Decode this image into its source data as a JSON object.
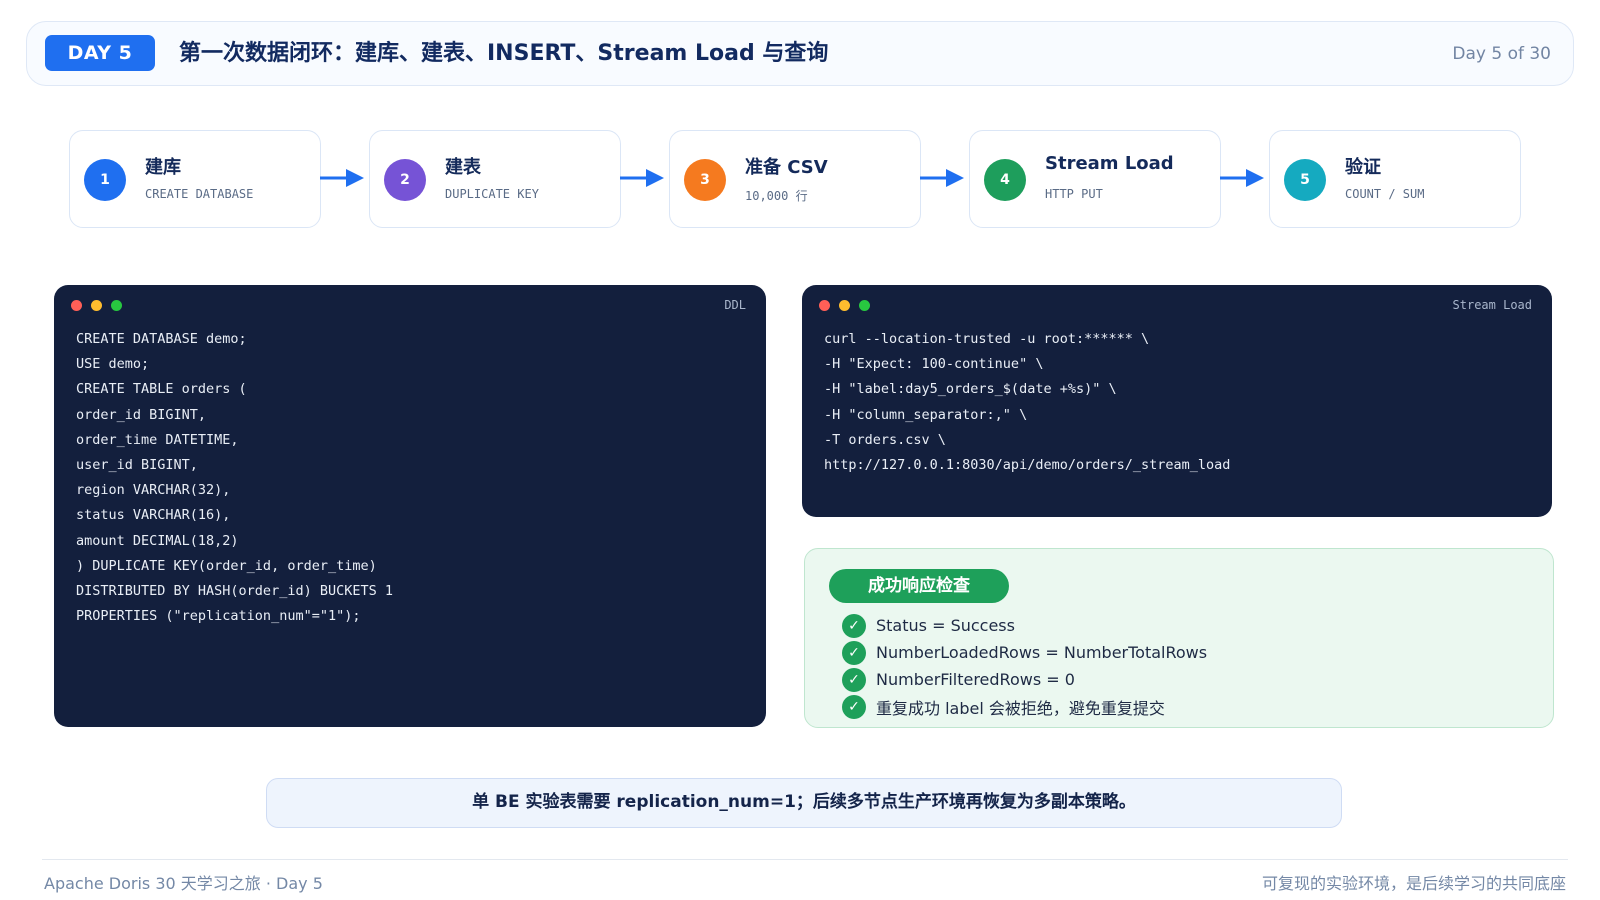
{
  "header": {
    "badge": "DAY 5",
    "title": "第一次数据闭环：建库、建表、INSERT、Stream Load 与查询",
    "progress": "Day 5 of 30"
  },
  "steps": [
    {
      "number": "1",
      "title": "建库",
      "subtitle": "CREATE DATABASE",
      "color": "#1f6ff0"
    },
    {
      "number": "2",
      "title": "建表",
      "subtitle": "DUPLICATE KEY",
      "color": "#7653d6"
    },
    {
      "number": "3",
      "title": "准备 CSV",
      "subtitle": "10,000 行",
      "color": "#f57a1f"
    },
    {
      "number": "4",
      "title": "Stream Load",
      "subtitle": "HTTP PUT",
      "color": "#1e9e5c"
    },
    {
      "number": "5",
      "title": "验证",
      "subtitle": "COUNT / SUM",
      "color": "#15aac0"
    }
  ],
  "ddl_panel": {
    "label": "DDL",
    "lines": [
      "CREATE DATABASE demo;",
      "USE demo;",
      "CREATE TABLE orders (",
      "order_id BIGINT,",
      "order_time DATETIME,",
      "user_id BIGINT,",
      "region VARCHAR(32),",
      "status VARCHAR(16),",
      "amount DECIMAL(18,2)",
      ") DUPLICATE KEY(order_id, order_time)",
      "DISTRIBUTED BY HASH(order_id) BUCKETS 1",
      "PROPERTIES (\"replication_num\"=\"1\");"
    ]
  },
  "stream_panel": {
    "label": "Stream Load",
    "lines": [
      "curl --location-trusted -u root:****** \\",
      "-H \"Expect: 100-continue\" \\",
      "-H \"label:day5_orders_$(date +%s)\" \\",
      "-H \"column_separator:,\" \\",
      "-T orders.csv \\",
      "http://127.0.0.1:8030/api/demo/orders/_stream_load"
    ]
  },
  "success_check": {
    "title": "成功响应检查",
    "items": [
      "Status = Success",
      "NumberLoadedRows = NumberTotalRows",
      "NumberFilteredRows = 0",
      "重复成功 label 会被拒绝，避免重复提交"
    ]
  },
  "note": "单 BE 实验表需要 replication_num=1；后续多节点生产环境再恢复为多副本策略。",
  "footer": {
    "left": "Apache Doris 30 天学习之旅 · Day 5",
    "right": "可复现的实验环境，是后续学习的共同底座"
  },
  "colors": {
    "accent": "#1f6ff0",
    "terminal_bg": "#131f3d",
    "success": "#1ea05a",
    "dot_red": "#ff5f57",
    "dot_yellow": "#febc2e",
    "dot_green": "#28c840"
  }
}
